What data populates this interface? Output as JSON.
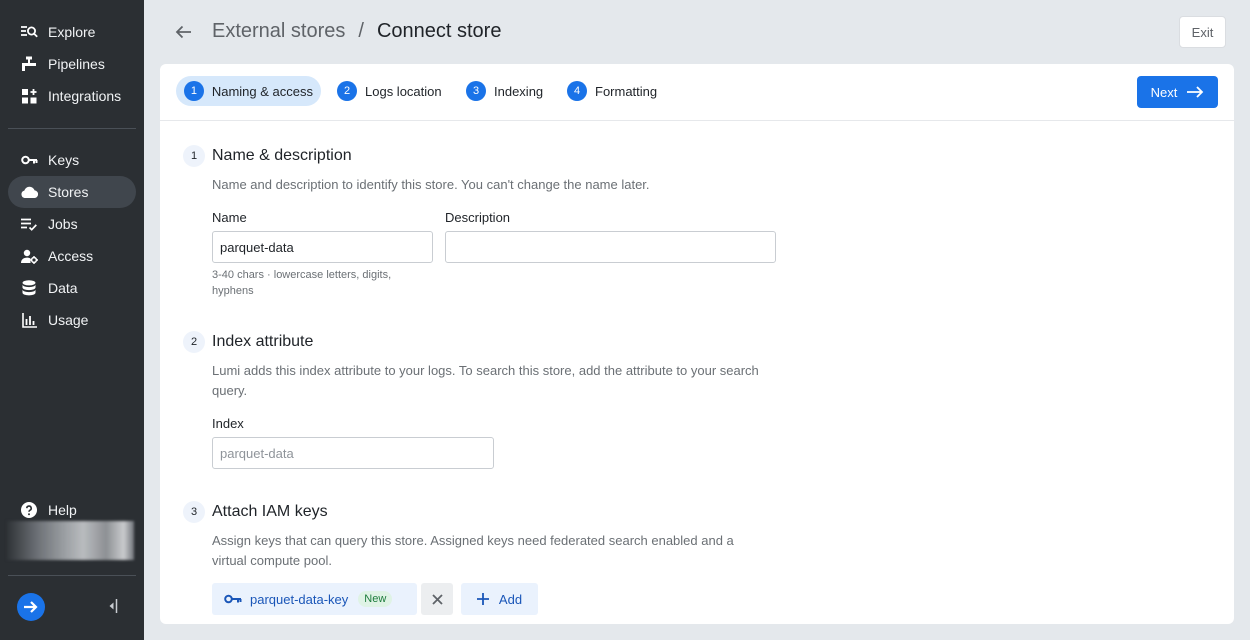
{
  "sidebar": {
    "items": [
      {
        "label": "Explore",
        "icon": "explore-icon"
      },
      {
        "label": "Pipelines",
        "icon": "pipelines-icon"
      },
      {
        "label": "Integrations",
        "icon": "integrations-icon"
      },
      {
        "label": "Keys",
        "icon": "key-icon"
      },
      {
        "label": "Stores",
        "icon": "cloud-icon",
        "active": true
      },
      {
        "label": "Jobs",
        "icon": "jobs-icon"
      },
      {
        "label": "Access",
        "icon": "access-icon"
      },
      {
        "label": "Data",
        "icon": "database-icon"
      },
      {
        "label": "Usage",
        "icon": "bar-chart-icon"
      }
    ],
    "help_label": "Help"
  },
  "header": {
    "parent": "External stores",
    "separator": "/",
    "title": "Connect store",
    "exit_label": "Exit"
  },
  "steps": [
    {
      "num": "1",
      "label": "Naming & access",
      "active": true
    },
    {
      "num": "2",
      "label": "Logs location"
    },
    {
      "num": "3",
      "label": "Indexing"
    },
    {
      "num": "4",
      "label": "Formatting"
    }
  ],
  "next_label": "Next",
  "sections": {
    "name": {
      "num": "1",
      "title": "Name & description",
      "desc": "Name and description to identify this store. You can't change the name later.",
      "name_label": "Name",
      "name_value": "parquet-data",
      "name_hint": "3-40 chars · lowercase letters, digits, hyphens",
      "desc_label": "Description",
      "desc_value": ""
    },
    "index": {
      "num": "2",
      "title": "Index attribute",
      "desc": "Lumi adds this index attribute to your logs. To search this store, add the attribute to your search query.",
      "label": "Index",
      "placeholder": "parquet-data"
    },
    "iam": {
      "num": "3",
      "title": "Attach IAM keys",
      "desc": "Assign keys that can query this store. Assigned keys need federated search enabled and a virtual compute pool.",
      "key_name": "parquet-data-key",
      "key_badge": "New",
      "add_label": "Add"
    }
  },
  "colors": {
    "accent": "#1a73e8",
    "sidebar_bg": "#2b2f33",
    "page_bg": "#e4e8ec"
  }
}
